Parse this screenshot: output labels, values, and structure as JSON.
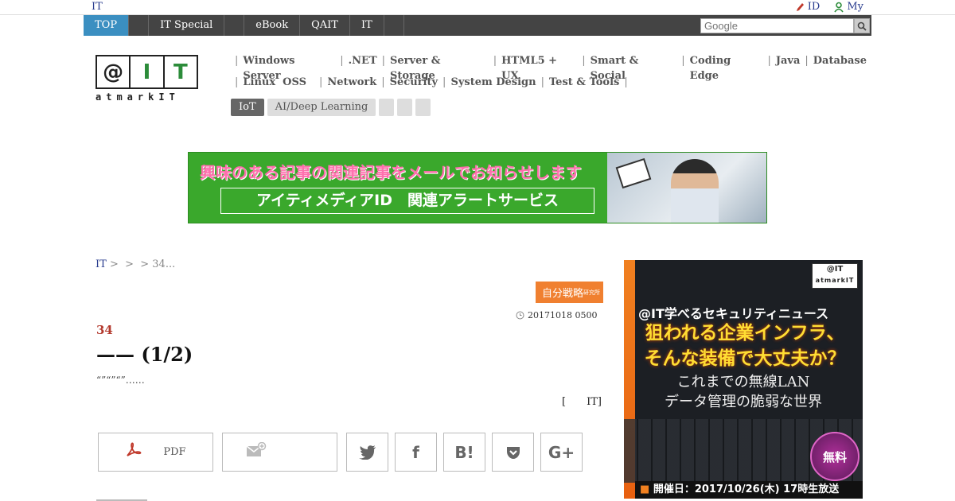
{
  "topbar": {
    "site_label": "IT",
    "id_link": "ID",
    "my_link": "My"
  },
  "nav": {
    "items": [
      "TOP",
      "",
      "IT Special",
      "",
      "eBook",
      "QAIT",
      "IT",
      ""
    ],
    "active_index": 0
  },
  "search": {
    "placeholder": "Google"
  },
  "logo": {
    "boxes": [
      "@",
      "I",
      "T"
    ],
    "sub": "atmarkIT"
  },
  "categories": {
    "row1": [
      "Windows Server",
      ".NET",
      "Server & Storage",
      "HTML5 + UX",
      "Smart & Social",
      "Coding Edge",
      "Java",
      "Database"
    ],
    "row2": [
      "Linux  OSS",
      "Network",
      "Security",
      "System Design",
      "Test & Tools"
    ],
    "tags": [
      "IoT",
      "AI/Deep Learning"
    ]
  },
  "banner": {
    "line1": "興味のある記事の関連記事をメールでお知らせします",
    "line2": "アイティメディアID　関連アラートサービス"
  },
  "breadcrumb": {
    "home": "IT",
    "rest": " >  >  > 34..."
  },
  "series_logo": {
    "text": "自分戦略",
    "sub": "研究所"
  },
  "article": {
    "date": "20171018 0500",
    "kicker": "34",
    "title": "—— (1/2)",
    "lead": "“”“”“”……",
    "author": "[　　IT]"
  },
  "share": {
    "pdf_label": "PDF"
  },
  "ad": {
    "badge_top": "@IT",
    "badge_bottom": "atmarkIT",
    "headline1": "@IT学べるセキュリティニュース",
    "headline2a": "狙われる企業インフラ、",
    "headline2b": "そんな装備で大丈夫か？",
    "headline3a": "これまでの無線LAN",
    "headline3b": "データ管理の脆弱な世界",
    "free": "無料",
    "date_label": "開催日：",
    "date": "2017/10/26(木) 17時生放送"
  }
}
